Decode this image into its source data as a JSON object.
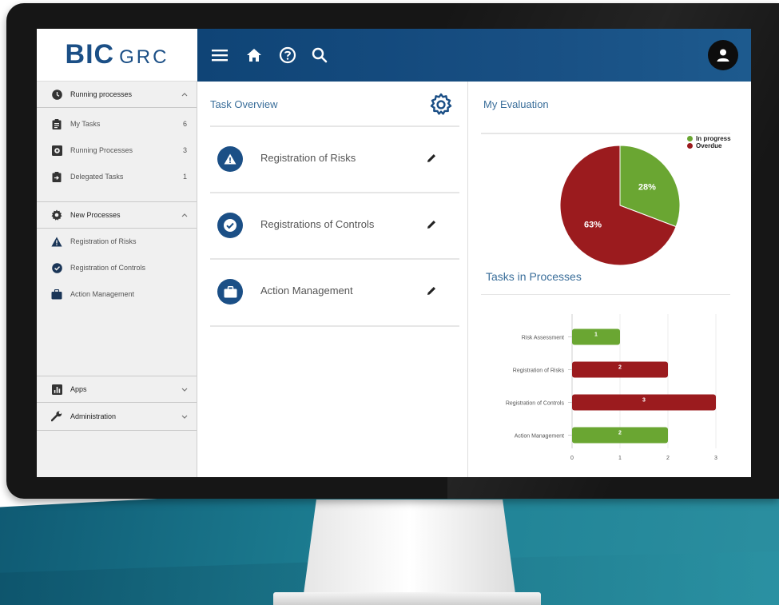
{
  "brand": {
    "main": "BIC",
    "sub": "GRC"
  },
  "topbar": {
    "menu_icon": "menu-icon",
    "home_icon": "home-icon",
    "help_icon": "help-icon",
    "search_icon": "search-icon",
    "avatar_icon": "user-avatar-icon"
  },
  "sidebar": {
    "running": {
      "label": "Running processes",
      "items": [
        {
          "label": "My Tasks",
          "count": "6",
          "icon": "clipboard-icon"
        },
        {
          "label": "Running Processes",
          "count": "3",
          "icon": "gear-icon"
        },
        {
          "label": "Delegated Tasks",
          "count": "1",
          "icon": "delegate-icon"
        }
      ]
    },
    "new": {
      "label": "New Processes",
      "items": [
        {
          "label": "Registration of Risks",
          "icon": "warning-icon"
        },
        {
          "label": "Registration of Controls",
          "icon": "check-circle-icon"
        },
        {
          "label": "Action Management",
          "icon": "briefcase-icon"
        }
      ]
    },
    "apps": {
      "label": "Apps"
    },
    "admin": {
      "label": "Administration"
    }
  },
  "task_overview": {
    "title": "Task Overview",
    "tasks": [
      {
        "label": "Registration of Risks",
        "icon": "warning-icon"
      },
      {
        "label": "Registrations of Controls",
        "icon": "check-circle-icon"
      },
      {
        "label": "Action Management",
        "icon": "briefcase-icon"
      }
    ]
  },
  "evaluation": {
    "title": "My Evaluation",
    "tasks_title": "Tasks in Processes"
  },
  "colors": {
    "navy": "#1b4f86",
    "green": "#6aa632",
    "red": "#9b1b1e"
  },
  "chart_data": [
    {
      "type": "pie",
      "title": "My Evaluation",
      "series": [
        {
          "name": "In progress",
          "value": 28,
          "label": "28%",
          "color": "#6aa632"
        },
        {
          "name": "Overdue",
          "value": 63,
          "label": "63%",
          "color": "#9b1b1e"
        }
      ],
      "legend": "top-right"
    },
    {
      "type": "bar",
      "orientation": "horizontal",
      "title": "Tasks in Processes",
      "categories": [
        "Risk Assessment",
        "Registration of Risks",
        "Registration of Controls",
        "Action Management"
      ],
      "values": [
        1,
        2,
        3,
        2
      ],
      "value_labels": [
        "1",
        "2",
        "3",
        "2"
      ],
      "colors": [
        "#6aa632",
        "#9b1b1e",
        "#9b1b1e",
        "#6aa632"
      ],
      "xlim": [
        0,
        3
      ],
      "xticks": [
        "0",
        "1",
        "2",
        "3"
      ],
      "grid": true
    }
  ]
}
